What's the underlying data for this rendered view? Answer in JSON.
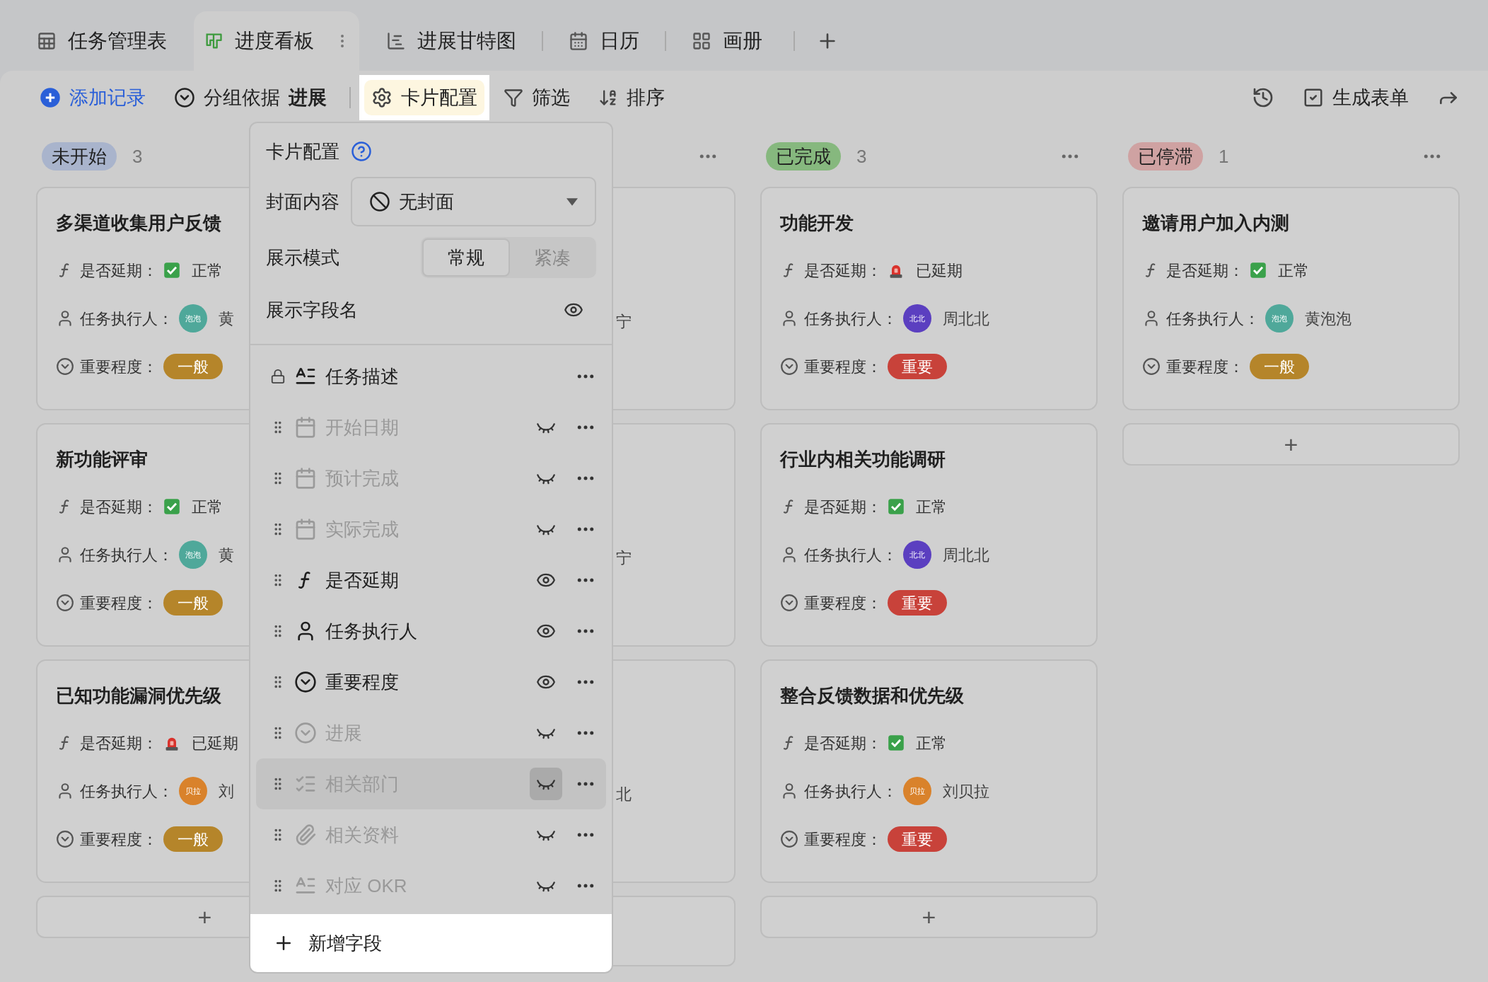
{
  "tabs": [
    {
      "label": "任务管理表",
      "kind": "table",
      "selected": false
    },
    {
      "label": "进度看板",
      "kind": "kanban",
      "selected": true
    },
    {
      "label": "进展甘特图",
      "kind": "gantt",
      "selected": false
    },
    {
      "label": "日历",
      "kind": "calendar",
      "selected": false
    },
    {
      "label": "画册",
      "kind": "gallery",
      "selected": false
    }
  ],
  "toolbar": {
    "add_record": "添加记录",
    "group_by": {
      "label": "分组依据",
      "value": "进展"
    },
    "card_config": {
      "label": "卡片配置",
      "highlighted": true
    },
    "filter": "筛选",
    "sort": "排序",
    "form": "生成表单"
  },
  "columns": [
    {
      "label": "未开始",
      "count": "3",
      "color": "#a9b4cc",
      "add": "+",
      "cards": [
        {
          "kind": "full",
          "title": "多渠道收集用户反馈",
          "fields": {
            "delay": {
              "label": "是否延期：",
              "delayed": false,
              "value": "正常"
            },
            "assignee": {
              "label": "任务执行人：",
              "avatar": "泡泡",
              "color": "#4fa89a",
              "name": "黄"
            },
            "importance": {
              "label": "重要程度：",
              "value": "一般",
              "color": "#b5852a"
            }
          }
        },
        {
          "kind": "full",
          "title": "新功能评审",
          "fields": {
            "delay": {
              "label": "是否延期：",
              "delayed": false,
              "value": "正常"
            },
            "assignee": {
              "label": "任务执行人：",
              "avatar": "泡泡",
              "color": "#4fa89a",
              "name": "黄"
            },
            "importance": {
              "label": "重要程度：",
              "value": "一般",
              "color": "#b5852a"
            }
          }
        },
        {
          "kind": "full",
          "title": "已知功能漏洞优先级",
          "fields": {
            "delay": {
              "label": "是否延期：",
              "delayed": true,
              "value": "已延期"
            },
            "assignee": {
              "label": "任务执行人：",
              "avatar": "贝拉",
              "color": "#d9822b",
              "name": "刘"
            },
            "importance": {
              "label": "重要程度：",
              "value": "一般",
              "color": "#b5852a"
            }
          }
        }
      ]
    },
    {
      "menu": true,
      "cards": [
        {
          "kind": "covered",
          "fragment": "宁"
        },
        {
          "kind": "covered",
          "fragment": "宁"
        },
        {
          "kind": "covered",
          "fragment": "北"
        }
      ]
    },
    {
      "label": "已完成",
      "count": "3",
      "color": "#86b87e",
      "add": "+",
      "menu": true,
      "cards": [
        {
          "kind": "full",
          "title": "功能开发",
          "fields": {
            "delay": {
              "label": "是否延期：",
              "delayed": true,
              "value": "已延期"
            },
            "assignee": {
              "label": "任务执行人：",
              "avatar": "北北",
              "color": "#5b3fc0",
              "name": "周北北"
            },
            "importance": {
              "label": "重要程度：",
              "value": "重要",
              "color": "#c8423a"
            }
          }
        },
        {
          "kind": "full",
          "title": "行业内相关功能调研",
          "fields": {
            "delay": {
              "label": "是否延期：",
              "delayed": false,
              "value": "正常"
            },
            "assignee": {
              "label": "任务执行人：",
              "avatar": "北北",
              "color": "#5b3fc0",
              "name": "周北北"
            },
            "importance": {
              "label": "重要程度：",
              "value": "重要",
              "color": "#c8423a"
            }
          }
        },
        {
          "kind": "full",
          "title": "整合反馈数据和优先级",
          "fields": {
            "delay": {
              "label": "是否延期：",
              "delayed": false,
              "value": "正常"
            },
            "assignee": {
              "label": "任务执行人：",
              "avatar": "贝拉",
              "color": "#d9822b",
              "name": "刘贝拉"
            },
            "importance": {
              "label": "重要程度：",
              "value": "重要",
              "color": "#c8423a"
            }
          }
        }
      ]
    },
    {
      "label": "已停滞",
      "count": "1",
      "color": "#cfa2a2",
      "add": "+",
      "menu": true,
      "cards": [
        {
          "kind": "full",
          "title": "邀请用户加入内测",
          "fields": {
            "delay": {
              "label": "是否延期：",
              "delayed": false,
              "value": "正常"
            },
            "assignee": {
              "label": "任务执行人：",
              "avatar": "泡泡",
              "color": "#4fa89a",
              "name": "黄泡泡"
            },
            "importance": {
              "label": "重要程度：",
              "value": "一般",
              "color": "#b5852a"
            }
          }
        }
      ]
    }
  ],
  "popup": {
    "title": "卡片配置",
    "cover": {
      "label": "封面内容",
      "value": "无封面"
    },
    "display_mode": {
      "label": "展示模式",
      "options": [
        {
          "label": "常规",
          "selected": true
        },
        {
          "label": "紧凑",
          "selected": false
        }
      ]
    },
    "show_field_names": {
      "label": "展示字段名",
      "visible": true
    },
    "fields": [
      {
        "name": "任务描述",
        "kind": "text",
        "locked": true,
        "visible": true,
        "hovered": false
      },
      {
        "name": "开始日期",
        "kind": "date",
        "locked": false,
        "visible": false,
        "hovered": false
      },
      {
        "name": "预计完成",
        "kind": "date",
        "locked": false,
        "visible": false,
        "hovered": false
      },
      {
        "name": "实际完成",
        "kind": "date",
        "locked": false,
        "visible": false,
        "hovered": false
      },
      {
        "name": "是否延期",
        "kind": "formula",
        "locked": false,
        "visible": true,
        "hovered": false
      },
      {
        "name": "任务执行人",
        "kind": "person",
        "locked": false,
        "visible": true,
        "hovered": false
      },
      {
        "name": "重要程度",
        "kind": "select",
        "locked": false,
        "visible": true,
        "hovered": false
      },
      {
        "name": "进展",
        "kind": "select",
        "locked": false,
        "visible": false,
        "hovered": false
      },
      {
        "name": "相关部门",
        "kind": "multi",
        "locked": false,
        "visible": false,
        "hovered": true
      },
      {
        "name": "相关资料",
        "kind": "attachment",
        "locked": false,
        "visible": false,
        "hovered": false
      },
      {
        "name": "对应 OKR",
        "kind": "text",
        "locked": false,
        "visible": false,
        "hovered": false
      }
    ],
    "add_field": "新增字段"
  }
}
